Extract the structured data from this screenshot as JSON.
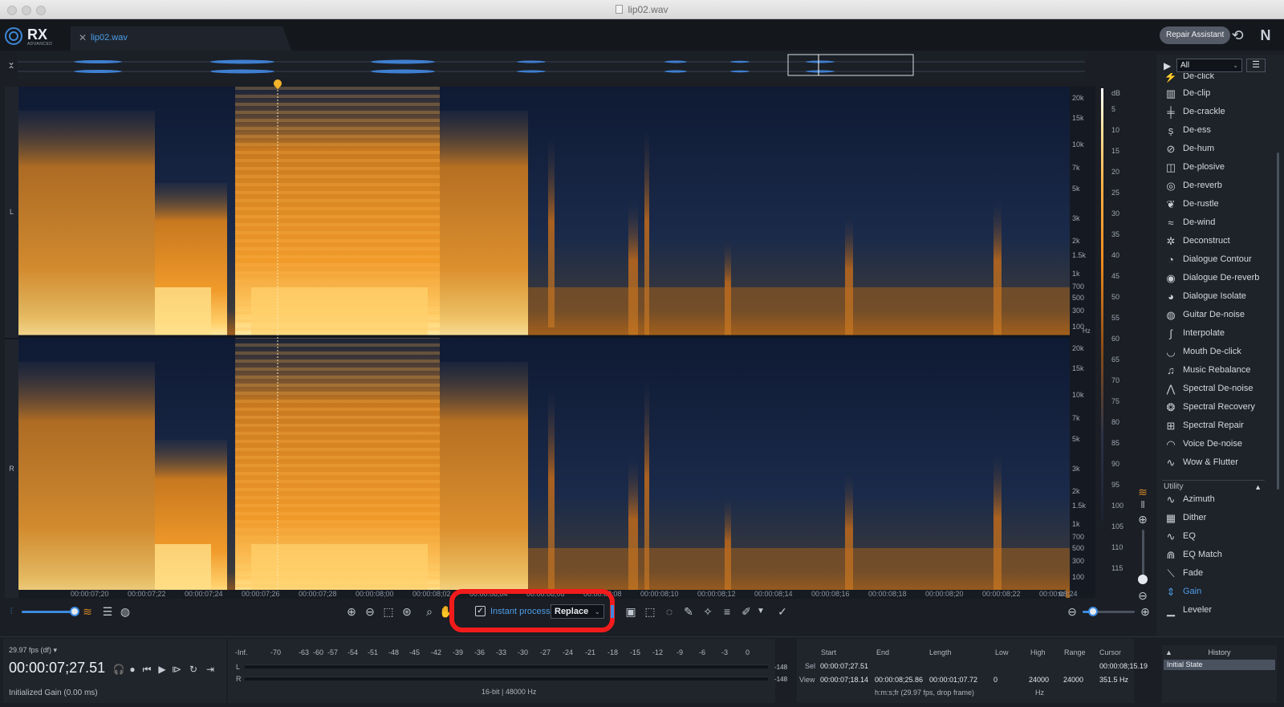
{
  "window": {
    "title": "lip02.wav"
  },
  "app": {
    "logo_text": "RX",
    "logo_sub": "ADVANCED"
  },
  "tabs": [
    {
      "label": "lip02.wav"
    }
  ],
  "header": {
    "repair_assistant_label": "Repair Assistant"
  },
  "channels": [
    "L",
    "R"
  ],
  "freq_ticks": [
    "20k",
    "15k",
    "10k",
    "7k",
    "5k",
    "3k",
    "2k",
    "1.5k",
    "1k",
    "700",
    "500",
    "300",
    "100"
  ],
  "freq_unit": "Hz",
  "db_unit": "dB",
  "db_ticks": [
    "5",
    "10",
    "15",
    "20",
    "25",
    "30",
    "35",
    "40",
    "45",
    "50",
    "55",
    "60",
    "65",
    "70",
    "75",
    "80",
    "85",
    "90",
    "95",
    "100",
    "105",
    "110",
    "115"
  ],
  "time_ticks": [
    "00:00:07;20",
    "00:00:07;22",
    "00:00:07;24",
    "00:00:07;26",
    "00:00:07;28",
    "00:00:08;00",
    "00:00:08;02",
    "00:00:08;04",
    "00:00:08;06",
    "00:00:08;08",
    "00:00:08;10",
    "00:00:08;12",
    "00:00:08;14",
    "00:00:08;16",
    "00:00:08;18",
    "00:00:08;20",
    "00:00:08;22",
    "00:00:08;24"
  ],
  "time_unit": "tc",
  "toolbar": {
    "instant_process_label": "Instant process",
    "instant_process_checked": true,
    "mode_value": "Replace"
  },
  "module_filter": {
    "value": "All"
  },
  "modules": [
    {
      "label": "De-click",
      "icon": "declick-icon"
    },
    {
      "label": "De-clip",
      "icon": "declip-icon"
    },
    {
      "label": "De-crackle",
      "icon": "decrackle-icon"
    },
    {
      "label": "De-ess",
      "icon": "deess-icon"
    },
    {
      "label": "De-hum",
      "icon": "dehum-icon"
    },
    {
      "label": "De-plosive",
      "icon": "deplosive-icon"
    },
    {
      "label": "De-reverb",
      "icon": "dereverb-icon"
    },
    {
      "label": "De-rustle",
      "icon": "derustle-icon"
    },
    {
      "label": "De-wind",
      "icon": "dewind-icon"
    },
    {
      "label": "Deconstruct",
      "icon": "deconstruct-icon"
    },
    {
      "label": "Dialogue Contour",
      "icon": "dialogue-contour-icon"
    },
    {
      "label": "Dialogue De-reverb",
      "icon": "dialogue-dereverb-icon"
    },
    {
      "label": "Dialogue Isolate",
      "icon": "dialogue-isolate-icon"
    },
    {
      "label": "Guitar De-noise",
      "icon": "guitar-denoise-icon"
    },
    {
      "label": "Interpolate",
      "icon": "interpolate-icon"
    },
    {
      "label": "Mouth De-click",
      "icon": "mouth-declick-icon"
    },
    {
      "label": "Music Rebalance",
      "icon": "music-rebalance-icon"
    },
    {
      "label": "Spectral De-noise",
      "icon": "spectral-denoise-icon"
    },
    {
      "label": "Spectral Recovery",
      "icon": "spectral-recovery-icon"
    },
    {
      "label": "Spectral Repair",
      "icon": "spectral-repair-icon"
    },
    {
      "label": "Voice De-noise",
      "icon": "voice-denoise-icon"
    },
    {
      "label": "Wow & Flutter",
      "icon": "wow-flutter-icon"
    }
  ],
  "utility_label": "Utility",
  "utility_modules": [
    {
      "label": "Azimuth",
      "icon": "azimuth-icon"
    },
    {
      "label": "Dither",
      "icon": "dither-icon"
    },
    {
      "label": "EQ",
      "icon": "eq-icon"
    },
    {
      "label": "EQ Match",
      "icon": "eq-match-icon"
    },
    {
      "label": "Fade",
      "icon": "fade-icon"
    },
    {
      "label": "Gain",
      "icon": "gain-icon",
      "active": true
    },
    {
      "label": "Leveler",
      "icon": "leveler-icon"
    }
  ],
  "transport": {
    "fps": "29.97 fps (df)",
    "timecode": "00:00:07;27.51",
    "status": "Initialized Gain (0.00 ms)"
  },
  "meter": {
    "scale": [
      "-Inf.",
      "-70",
      "-63",
      "-60",
      "-57",
      "-54",
      "-51",
      "-48",
      "-45",
      "-42",
      "-39",
      "-36",
      "-33",
      "-30",
      "-27",
      "-24",
      "-21",
      "-18",
      "-15",
      "-12",
      "-9",
      "-6",
      "-3",
      "0"
    ],
    "left_label": "L",
    "right_label": "R",
    "left_peak": "-148",
    "right_peak": "-148",
    "format": "16-bit | 48000 Hz"
  },
  "selection_info": {
    "headers": {
      "start": "Start",
      "end": "End",
      "length": "Length",
      "low": "Low",
      "high": "High",
      "range": "Range",
      "cursor": "Cursor"
    },
    "sel_label": "Sel",
    "view_label": "View",
    "sel": {
      "start": "00:00:07;27.51",
      "end": "",
      "length": ""
    },
    "view": {
      "start": "00:00:07;18.14",
      "end": "00:00:08;25.86",
      "length": "00:00:01;07.72",
      "low": "0",
      "high": "24000",
      "range": "24000"
    },
    "cursor_time": "00:00:08;15.19",
    "cursor_freq": "351.5 Hz",
    "time_format": "h:m:s;fr (29.97 fps, drop frame)",
    "freq_unit": "Hz"
  },
  "history": {
    "title": "History",
    "items": [
      "Initial State"
    ]
  }
}
